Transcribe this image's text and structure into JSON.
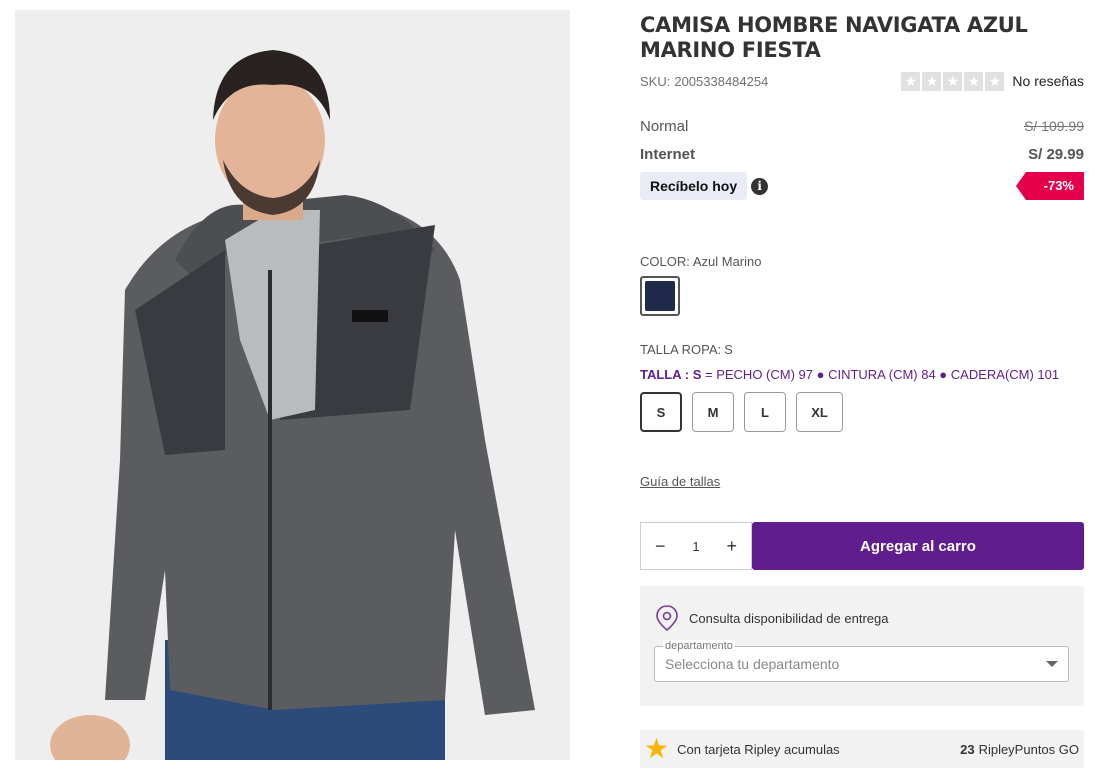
{
  "product": {
    "title": "CAMISA HOMBRE NAVIGATA AZUL MARINO FIESTA",
    "sku_label": "SKU:",
    "sku": "2005338484254",
    "rating_stars": 5,
    "reviews_text": "No reseñas"
  },
  "pricing": {
    "normal_label": "Normal",
    "normal_price": "S/ 109.99",
    "internet_label": "Internet",
    "internet_price": "S/ 29.99",
    "delivery_chip": "Recíbelo hoy",
    "info_icon": "i",
    "discount": "-73%"
  },
  "color": {
    "label": "COLOR:",
    "value": "Azul Marino",
    "swatch_hex": "#1f2a4a"
  },
  "size": {
    "label": "TALLA ROPA:",
    "value": "S",
    "detail_prefix": "TALLA : S",
    "detail_rest": " = PECHO (CM) 97 ● CINTURA (CM) 84 ● CADERA(CM) 101",
    "options": [
      "S",
      "M",
      "L",
      "XL"
    ],
    "selected": "S",
    "guide_link": "Guía de tallas"
  },
  "cart": {
    "minus": "−",
    "quantity": "1",
    "plus": "+",
    "add_button": "Agregar al carro"
  },
  "availability": {
    "text": "Consulta disponibilidad de entrega",
    "field_legend": "departamento",
    "field_placeholder": "Selecciona tu departamento"
  },
  "points": {
    "text": "Con tarjeta Ripley acumulas",
    "value": "23",
    "unit": "RipleyPuntos GO"
  },
  "colors": {
    "brand_purple": "#5f1d8e",
    "discount_red": "#e5004b",
    "star_yellow": "#f5b700"
  }
}
